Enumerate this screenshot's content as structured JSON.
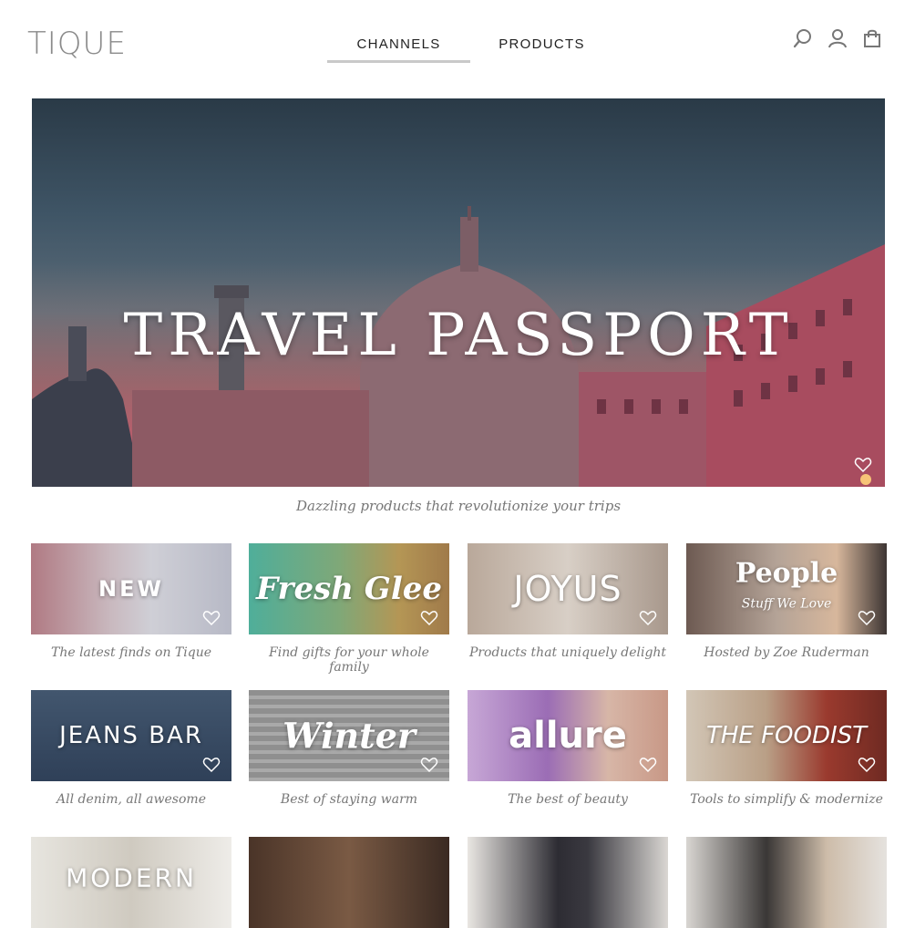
{
  "header": {
    "logo": "TIQUE",
    "tabs": [
      {
        "label": "CHANNELS",
        "active": true
      },
      {
        "label": "PRODUCTS",
        "active": false
      }
    ],
    "icons": [
      "search-icon",
      "account-icon",
      "shopping-bag-icon"
    ]
  },
  "hero": {
    "title": "TRAVEL PASSPORT",
    "caption": "Dazzling products that revolutionize your trips"
  },
  "channels": [
    {
      "label": "NEW",
      "caption": "The latest finds on Tique"
    },
    {
      "label": "Fresh Glee",
      "caption": "Find gifts for your whole family"
    },
    {
      "label": "JOYUS",
      "caption": "Products that uniquely delight"
    },
    {
      "label": "People",
      "sublabel": "Stuff We Love",
      "caption": "Hosted by Zoe Ruderman"
    },
    {
      "label": "JEANS BAR",
      "caption": "All denim, all awesome"
    },
    {
      "label": "Winter",
      "caption": "Best of staying warm"
    },
    {
      "label": "allure",
      "caption": "The best of beauty"
    },
    {
      "label": "THE FOODIST",
      "caption": "Tools to simplify & modernize"
    },
    {
      "label": "MODERN",
      "caption": ""
    },
    {
      "label": "",
      "caption": ""
    },
    {
      "label": "",
      "caption": ""
    },
    {
      "label": "",
      "caption": ""
    }
  ],
  "colors": {
    "logo": "#8a8a8a",
    "tab_underline": "#c9c9c9",
    "caption_text": "#777777"
  }
}
